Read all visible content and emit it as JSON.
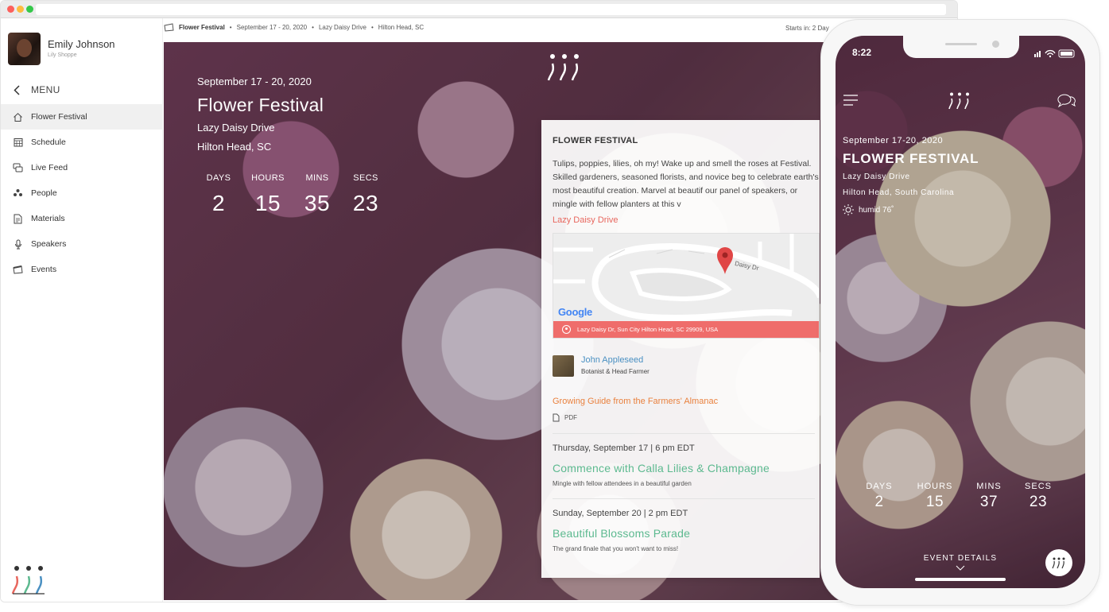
{
  "user": {
    "name": "Emily Johnson",
    "company": "Lily Shoppe"
  },
  "sidebar": {
    "menu_label": "MENU",
    "items": [
      {
        "label": "Flower Festival",
        "icon": "home-icon"
      },
      {
        "label": "Schedule",
        "icon": "calendar-icon"
      },
      {
        "label": "Live Feed",
        "icon": "feed-icon"
      },
      {
        "label": "People",
        "icon": "people-icon"
      },
      {
        "label": "Materials",
        "icon": "document-icon"
      },
      {
        "label": "Speakers",
        "icon": "microphone-icon"
      },
      {
        "label": "Events",
        "icon": "events-icon"
      }
    ]
  },
  "topbar": {
    "event_name": "Flower Festival",
    "dates": "September 17 - 20, 2020",
    "street": "Lazy Daisy Drive",
    "city": "Hilton Head, SC",
    "separator": "•",
    "starts_in": "Starts in:  2 Day"
  },
  "hero": {
    "date": "September 17 - 20, 2020",
    "title": "Flower Festival",
    "street": "Lazy Daisy Drive",
    "city": "Hilton Head, SC",
    "countdown": [
      {
        "label": "DAYS",
        "value": "2"
      },
      {
        "label": "HOURS",
        "value": "15"
      },
      {
        "label": "MINS",
        "value": "35"
      },
      {
        "label": "SECS",
        "value": "23"
      }
    ]
  },
  "panel": {
    "title": "FLOWER FESTIVAL",
    "description": "Tulips, poppies, lilies, oh my! Wake up and smell the roses at Festival. Skilled gardeners, seasoned florists, and novice beg to celebrate earth's most beautiful creation. Marvel at beautif our panel of speakers, or mingle with fellow planters at this v",
    "location_link": "Lazy Daisy Drive",
    "map": {
      "street_label": "Daisy Dr",
      "google": "Google",
      "address": "Lazy Daisy Dr, Sun City Hilton Head, SC 29909, USA"
    },
    "speaker": {
      "name": "John Appleseed",
      "role": "Botanist & Head Farmer"
    },
    "material": {
      "title": "Growing Guide from the Farmers' Almanac",
      "type": "PDF"
    },
    "events": [
      {
        "date": "Thursday, September 17 | 6 pm EDT",
        "title": "Commence with Calla Lilies & Champagne",
        "subtitle": "Mingle with fellow attendees in a beautiful garden"
      },
      {
        "date": "Sunday, September 20 | 2 pm EDT",
        "title": "Beautiful Blossoms Parade",
        "subtitle": "The grand finale that you won't want to miss!"
      }
    ]
  },
  "phone": {
    "time": "8:22",
    "date": "September 17-20, 2020",
    "title": "FLOWER FESTIVAL",
    "street": "Lazy Daisy Drive",
    "city": "Hilton Head, South Carolina",
    "weather": "humid 76˚",
    "countdown": [
      {
        "label": "DAYS",
        "value": "2"
      },
      {
        "label": "HOURS",
        "value": "15"
      },
      {
        "label": "MINS",
        "value": "37"
      },
      {
        "label": "SECS",
        "value": "23"
      }
    ],
    "details_label": "EVENT DETAILS"
  },
  "colors": {
    "accent_red": "#e8675e",
    "accent_orange": "#e9813e",
    "accent_green": "#5cb98f",
    "link_blue": "#4a90c2",
    "map_bar": "#ef6d6b"
  }
}
